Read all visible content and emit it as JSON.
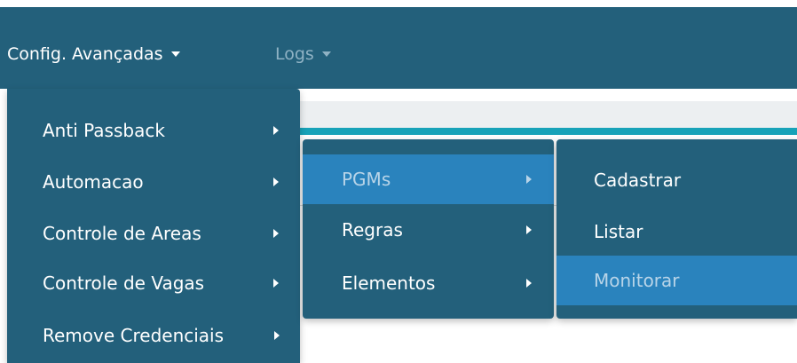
{
  "navbar": {
    "items": [
      {
        "label": "Config. Avançadas",
        "icon": "caret-down-icon",
        "state": "open"
      },
      {
        "label": "Logs",
        "icon": "caret-down-icon",
        "state": "muted"
      }
    ]
  },
  "menu_level1": {
    "items": [
      {
        "label": "Anti Passback",
        "icon": "chevron-right-icon"
      },
      {
        "label": "Automacao",
        "icon": "chevron-right-icon"
      },
      {
        "label": "Controle de Areas",
        "icon": "chevron-right-icon"
      },
      {
        "label": "Controle de Vagas",
        "icon": "chevron-right-icon"
      },
      {
        "label": "Remove Credenciais",
        "icon": "chevron-right-icon"
      }
    ]
  },
  "menu_level2": {
    "items": [
      {
        "label": "PGMs",
        "icon": "chevron-right-icon",
        "active": true
      },
      {
        "label": "Regras",
        "icon": "chevron-right-icon"
      },
      {
        "label": "Elementos",
        "icon": "chevron-right-icon"
      }
    ]
  },
  "menu_level3": {
    "items": [
      {
        "label": "Cadastrar"
      },
      {
        "label": "Listar"
      },
      {
        "label": "Monitorar",
        "active": true
      }
    ]
  },
  "colors": {
    "navbar_bg": "#23607b",
    "menu_bg": "#23607b",
    "active_bg": "#2a83bd",
    "active_text": "#b8d4e8",
    "accent_teal": "#17a2b8",
    "muted_text": "#8fb2c4"
  }
}
